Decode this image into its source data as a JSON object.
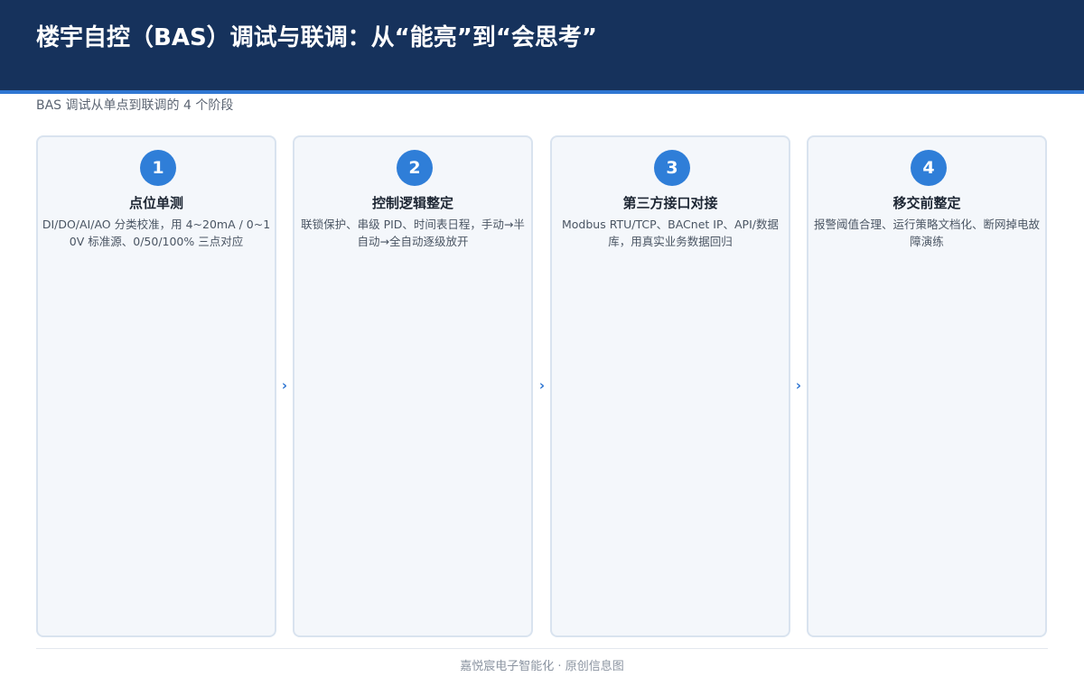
{
  "header": {
    "title": "楼宇自控（BAS）调试与联调：从“能亮”到“会思考”",
    "subtitle": "BAS 调试从单点到联调的 4 个阶段"
  },
  "steps": [
    {
      "number": "1",
      "title": "点位单测",
      "description": "DI/DO/AI/AO 分类校准，用 4~20mA / 0~10V 标准源、0/50/100% 三点对应"
    },
    {
      "number": "2",
      "title": "控制逻辑整定",
      "description": "联锁保护、串级 PID、时间表日程，手动→半自动→全自动逐级放开"
    },
    {
      "number": "3",
      "title": "第三方接口对接",
      "description": "Modbus RTU/TCP、BACnet IP、API/数据库，用真实业务数据回归"
    },
    {
      "number": "4",
      "title": "移交前整定",
      "description": "报警阈值合理、运行策略文档化、断网掉电故障演练"
    }
  ],
  "arrows": [
    "›",
    "›",
    "›"
  ],
  "footer": {
    "text": "嘉悦宸电子智能化 · 原创信息图"
  },
  "colors": {
    "header_bg": "#16325c",
    "accent": "#2f76d2",
    "card_bg": "#f4f7fb",
    "card_border": "#d9e3ef"
  }
}
